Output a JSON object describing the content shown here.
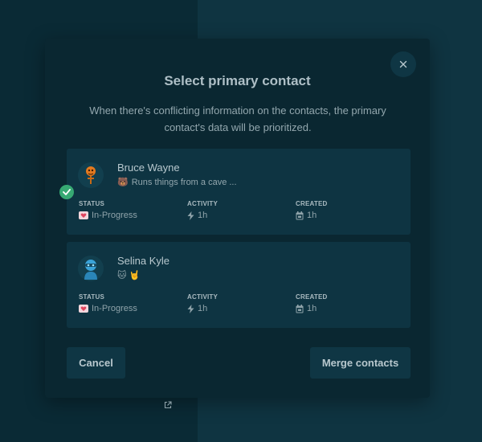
{
  "modal": {
    "title": "Select primary contact",
    "subtitle": "When there's conflicting information on the contacts, the primary contact's data will be prioritized."
  },
  "contacts": [
    {
      "name": "Bruce Wayne",
      "description_emoji": "🐻",
      "description": "Runs things from a cave ...",
      "selected": true,
      "status_label": "STATUS",
      "status_icon": "heart-badge-icon",
      "status": "In-Progress",
      "activity_label": "ACTIVITY",
      "activity_icon": "lightning-icon",
      "activity": "1h",
      "created_label": "CREATED",
      "created_icon": "calendar-icon",
      "created": "1h"
    },
    {
      "name": "Selina Kyle",
      "description_emoji": "🐱 🤘",
      "description": "",
      "selected": false,
      "status_label": "STATUS",
      "status_icon": "heart-badge-icon",
      "status": "In-Progress",
      "activity_label": "ACTIVITY",
      "activity_icon": "lightning-icon",
      "activity": "1h",
      "created_label": "CREATED",
      "created_icon": "calendar-icon",
      "created": "1h"
    }
  ],
  "buttons": {
    "cancel": "Cancel",
    "merge": "Merge contacts"
  },
  "colors": {
    "background_left": "#0a2a35",
    "background_right": "#0f3441",
    "modal": "#0a2731",
    "card": "#0e3442",
    "selected_check": "#37a973"
  }
}
